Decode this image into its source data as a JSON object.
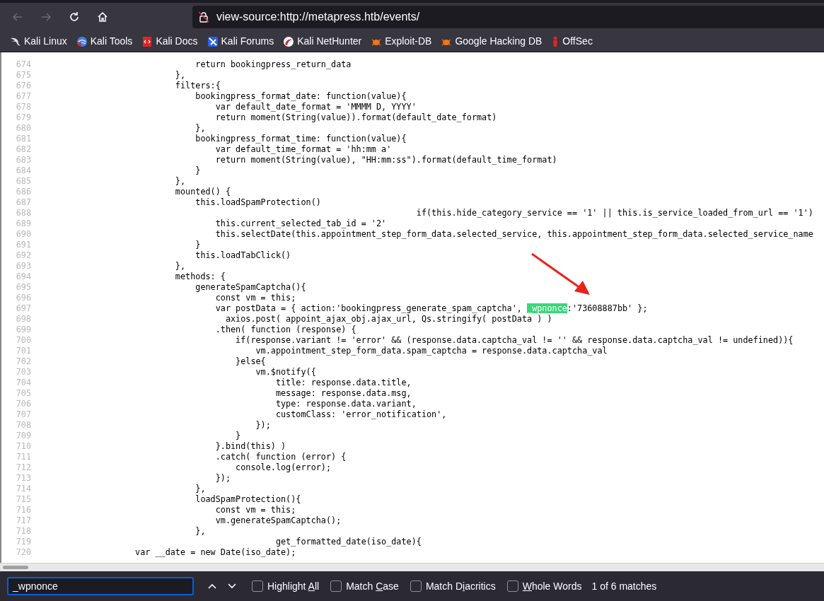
{
  "toolbar": {
    "back": {
      "disabled": true
    },
    "forward": {
      "disabled": true
    },
    "url": "view-source:http://metapress.htb/events/"
  },
  "bookmarks": [
    {
      "label": "Kali Linux",
      "kind": "dragon"
    },
    {
      "label": "Kali Tools",
      "kind": "tools"
    },
    {
      "label": "Kali Docs",
      "kind": "docs"
    },
    {
      "label": "Kali Forums",
      "kind": "forums"
    },
    {
      "label": "Kali NetHunter",
      "kind": "nethunter"
    },
    {
      "label": "Exploit-DB",
      "kind": "bug"
    },
    {
      "label": "Google Hacking DB",
      "kind": "bug"
    },
    {
      "label": "OffSec",
      "kind": "offsec"
    }
  ],
  "source_lines": [
    {
      "number": "674",
      "code": "                                return bookingpress_return_data"
    },
    {
      "number": "675",
      "code": "                            },"
    },
    {
      "number": "676",
      "code": "                            filters:{"
    },
    {
      "number": "677",
      "code": "                                bookingpress_format_date: function(value){"
    },
    {
      "number": "678",
      "code": "                                    var default_date_format = 'MMMM D, YYYY'"
    },
    {
      "number": "679",
      "code": "                                    return moment(String(value)).format(default_date_format)"
    },
    {
      "number": "680",
      "code": "                                },"
    },
    {
      "number": "681",
      "code": "                                bookingpress_format_time: function(value){"
    },
    {
      "number": "682",
      "code": "                                    var default_time_format = 'hh:mm a'"
    },
    {
      "number": "683",
      "code": "                                    return moment(String(value), \"HH:mm:ss\").format(default_time_format)"
    },
    {
      "number": "684",
      "code": "                                }"
    },
    {
      "number": "685",
      "code": "                            },"
    },
    {
      "number": "686",
      "code": "                            mounted() {"
    },
    {
      "number": "687",
      "code": "                                this.loadSpamProtection()"
    },
    {
      "number": "688",
      "code": "                                                                            if(this.hide_category_service == '1' || this.is_service_loaded_from_url == '1')"
    },
    {
      "number": "689",
      "code": "                                    this.current_selected_tab_id = '2'"
    },
    {
      "number": "690",
      "code": "                                    this.selectDate(this.appointment_step_form_data.selected_service, this.appointment_step_form_data.selected_service_name"
    },
    {
      "number": "691",
      "code": "                                }"
    },
    {
      "number": "692",
      "code": "                                this.loadTabClick()"
    },
    {
      "number": "693",
      "code": "                            },"
    },
    {
      "number": "694",
      "code": "                            methods: {"
    },
    {
      "number": "695",
      "code": "                                generateSpamCaptcha(){"
    },
    {
      "number": "696",
      "code": "                                    const vm = this;"
    },
    {
      "number": "697",
      "parts": [
        {
          "text": "                                    var postData = { action:'bookingpress_generate_spam_captcha', ",
          "highlighted": false
        },
        {
          "text": "_wpnonce",
          "highlighted": true
        },
        {
          "text": ":'73608887bb' };",
          "highlighted": false
        }
      ]
    },
    {
      "number": "698",
      "code": "                                      axios.post( appoint_ajax_obj.ajax_url, Qs.stringify( postData ) )"
    },
    {
      "number": "699",
      "code": "                                    .then( function (response) {"
    },
    {
      "number": "700",
      "code": "                                        if(response.variant != 'error' && (response.data.captcha_val != '' && response.data.captcha_val != undefined)){"
    },
    {
      "number": "701",
      "code": "                                            vm.appointment_step_form_data.spam_captcha = response.data.captcha_val"
    },
    {
      "number": "702",
      "code": "                                        }else{"
    },
    {
      "number": "703",
      "code": "                                            vm.$notify({"
    },
    {
      "number": "704",
      "code": "                                                title: response.data.title,"
    },
    {
      "number": "705",
      "code": "                                                message: response.data.msg,"
    },
    {
      "number": "706",
      "code": "                                                type: response.data.variant,"
    },
    {
      "number": "707",
      "code": "                                                customClass: 'error_notification',"
    },
    {
      "number": "708",
      "code": "                                            });"
    },
    {
      "number": "709",
      "code": "                                        }"
    },
    {
      "number": "710",
      "code": "                                    }.bind(this) )"
    },
    {
      "number": "711",
      "code": "                                    .catch( function (error) {"
    },
    {
      "number": "712",
      "code": "                                        console.log(error);"
    },
    {
      "number": "713",
      "code": "                                    });"
    },
    {
      "number": "714",
      "code": "                                },"
    },
    {
      "number": "715",
      "code": "                                loadSpamProtection(){"
    },
    {
      "number": "716",
      "code": "                                    const vm = this;"
    },
    {
      "number": "717",
      "code": "                                    vm.generateSpamCaptcha();"
    },
    {
      "number": "718",
      "code": "                                },"
    },
    {
      "number": "719",
      "code": "                                                get_formatted_date(iso_date){"
    },
    {
      "number": "720",
      "code": "                    var __date = new Date(iso_date);"
    }
  ],
  "find_bar": {
    "query": "_wpnonce",
    "options": [
      {
        "before": "Highlight ",
        "access_key": "A",
        "after": "ll",
        "checked": false
      },
      {
        "before": "Match ",
        "access_key": "C",
        "after": "ase",
        "checked": false
      },
      {
        "before": "Match D",
        "access_key": "i",
        "after": "acritics",
        "checked": false
      },
      {
        "access_key": "W",
        "after": "hole Words",
        "checked": false
      }
    ],
    "status": "1 of 6 matches"
  }
}
